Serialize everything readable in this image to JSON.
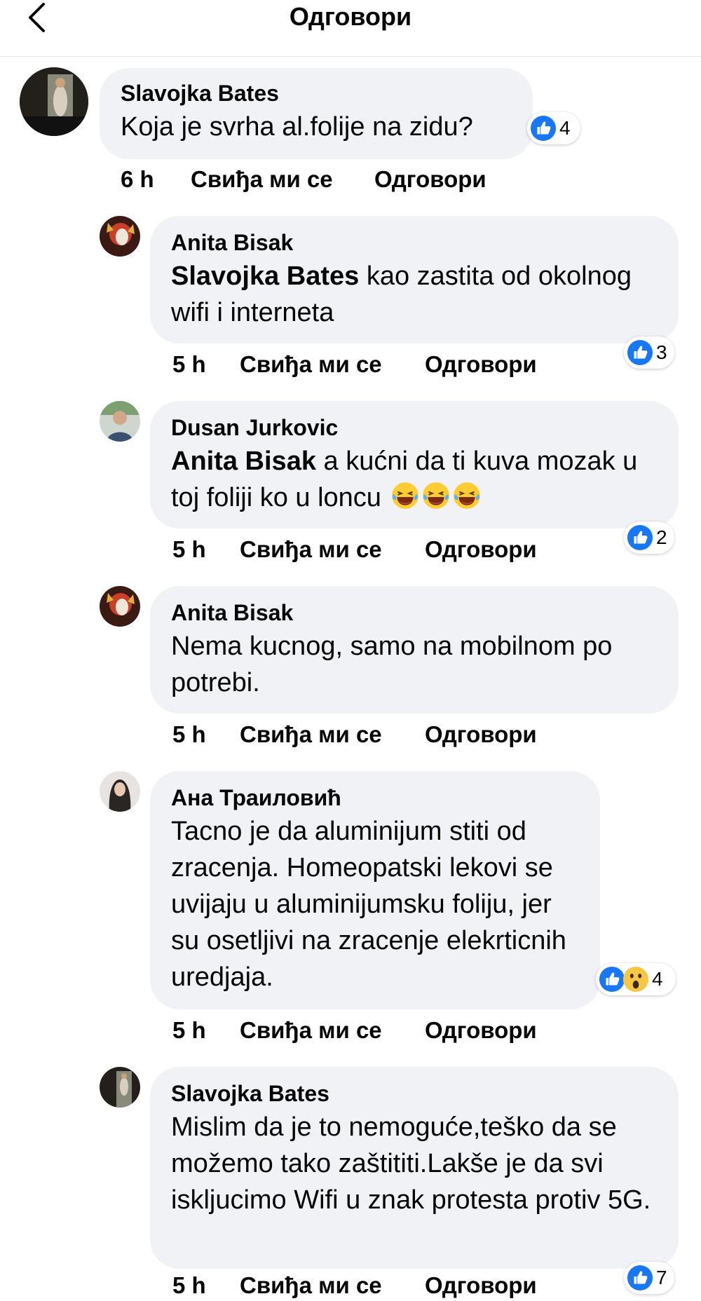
{
  "header": {
    "title": "Одговори"
  },
  "actions": {
    "like": "Свиђа ми се",
    "reply": "Одговори"
  },
  "comments": [
    {
      "author": "Slavojka Bates",
      "mention": "",
      "text": "Koja je svrha al.folije na zidu?",
      "time": "6 h",
      "reaction_count": "4"
    },
    {
      "author": "Anita Bisak",
      "mention": "Slavojka Bates",
      "text": " kao zastita od okolnog wifi i interneta",
      "time": "5 h",
      "reaction_count": "3"
    },
    {
      "author": "Dusan Jurkovic",
      "mention": "Anita Bisak",
      "text": " a kućni da ti kuva mozak u toj foliji ko u loncu ",
      "time": "5 h",
      "reaction_count": "2",
      "emoji": [
        "laughing-tears-emoji",
        "laughing-tears-emoji",
        "laughing-tears-emoji"
      ]
    },
    {
      "author": "Anita Bisak",
      "mention": "",
      "text": "Nema kucnog, samo na mobilnom po potrebi.",
      "time": "5 h",
      "reaction_count": ""
    },
    {
      "author": "Ана Траиловић",
      "mention": "",
      "text": "Tacno je da aluminijum stiti od zracenja. Homeopatski lekovi se uvijaju u aluminijumsku foliju, jer su osetljivi na zracenje elekrticnih uredjaja.",
      "time": "5 h",
      "reaction_count": "4"
    },
    {
      "author": "Slavojka Bates",
      "mention": "",
      "text": "Mislim da je to nemoguće,teško da se možemo tako zaštititi.Lakše je da svi iskljucimo Wifi u znak protesta protiv 5G.",
      "time": "5 h",
      "reaction_count": "7"
    }
  ],
  "colors": {
    "bubble": "#f0f2f5",
    "like_blue": "#1877f2",
    "wow_yellow": "#f7c744"
  }
}
